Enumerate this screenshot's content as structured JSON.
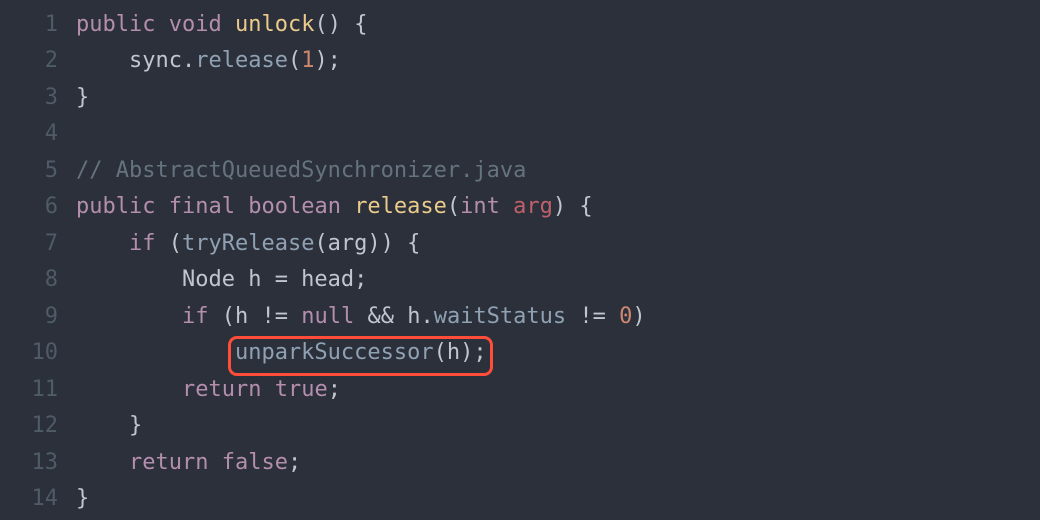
{
  "editor": {
    "language": "java",
    "theme": "dark",
    "highlight": {
      "line": 10,
      "text": "unparkSuccessor(h);"
    },
    "lines": [
      {
        "num": "1",
        "tokens": [
          {
            "t": "kw",
            "v": "public"
          },
          {
            "t": "sp",
            "v": " "
          },
          {
            "t": "kw",
            "v": "void"
          },
          {
            "t": "sp",
            "v": " "
          },
          {
            "t": "fn",
            "v": "unlock"
          },
          {
            "t": "op",
            "v": "() {"
          }
        ]
      },
      {
        "num": "2",
        "indent": "    ",
        "tokens": [
          {
            "t": "id",
            "v": "sync"
          },
          {
            "t": "op",
            "v": "."
          },
          {
            "t": "call",
            "v": "release"
          },
          {
            "t": "op",
            "v": "("
          },
          {
            "t": "num",
            "v": "1"
          },
          {
            "t": "op",
            "v": ");"
          }
        ]
      },
      {
        "num": "3",
        "tokens": [
          {
            "t": "op",
            "v": "}"
          }
        ]
      },
      {
        "num": "4",
        "tokens": []
      },
      {
        "num": "5",
        "tokens": [
          {
            "t": "comm",
            "v": "// AbstractQueuedSynchronizer.java"
          }
        ]
      },
      {
        "num": "6",
        "tokens": [
          {
            "t": "kw",
            "v": "public"
          },
          {
            "t": "sp",
            "v": " "
          },
          {
            "t": "kw",
            "v": "final"
          },
          {
            "t": "sp",
            "v": " "
          },
          {
            "t": "kw",
            "v": "boolean"
          },
          {
            "t": "sp",
            "v": " "
          },
          {
            "t": "fn",
            "v": "release"
          },
          {
            "t": "op",
            "v": "("
          },
          {
            "t": "kw",
            "v": "int"
          },
          {
            "t": "sp",
            "v": " "
          },
          {
            "t": "param",
            "v": "arg"
          },
          {
            "t": "op",
            "v": ") {"
          }
        ]
      },
      {
        "num": "7",
        "indent": "    ",
        "tokens": [
          {
            "t": "kw",
            "v": "if"
          },
          {
            "t": "sp",
            "v": " "
          },
          {
            "t": "op",
            "v": "("
          },
          {
            "t": "call",
            "v": "tryRelease"
          },
          {
            "t": "op",
            "v": "(arg)) {"
          }
        ]
      },
      {
        "num": "8",
        "indent": "        ",
        "tokens": [
          {
            "t": "id",
            "v": "Node h "
          },
          {
            "t": "op",
            "v": "="
          },
          {
            "t": "id",
            "v": " head;"
          }
        ]
      },
      {
        "num": "9",
        "indent": "        ",
        "tokens": [
          {
            "t": "kw",
            "v": "if"
          },
          {
            "t": "sp",
            "v": " "
          },
          {
            "t": "op",
            "v": "(h "
          },
          {
            "t": "op",
            "v": "!="
          },
          {
            "t": "sp",
            "v": " "
          },
          {
            "t": "kw",
            "v": "null"
          },
          {
            "t": "sp",
            "v": " "
          },
          {
            "t": "op",
            "v": "&&"
          },
          {
            "t": "sp",
            "v": " "
          },
          {
            "t": "id",
            "v": "h"
          },
          {
            "t": "op",
            "v": "."
          },
          {
            "t": "call",
            "v": "waitStatus"
          },
          {
            "t": "sp",
            "v": " "
          },
          {
            "t": "op",
            "v": "!="
          },
          {
            "t": "sp",
            "v": " "
          },
          {
            "t": "num",
            "v": "0"
          },
          {
            "t": "op",
            "v": ")"
          }
        ]
      },
      {
        "num": "10",
        "indent": "            ",
        "tokens": [
          {
            "t": "call",
            "v": "unparkSuccessor"
          },
          {
            "t": "op",
            "v": "(h);"
          }
        ]
      },
      {
        "num": "11",
        "indent": "        ",
        "tokens": [
          {
            "t": "kw",
            "v": "return"
          },
          {
            "t": "sp",
            "v": " "
          },
          {
            "t": "kw",
            "v": "true"
          },
          {
            "t": "op",
            "v": ";"
          }
        ]
      },
      {
        "num": "12",
        "indent": "    ",
        "tokens": [
          {
            "t": "op",
            "v": "}"
          }
        ]
      },
      {
        "num": "13",
        "indent": "    ",
        "tokens": [
          {
            "t": "kw",
            "v": "return"
          },
          {
            "t": "sp",
            "v": " "
          },
          {
            "t": "kw",
            "v": "false"
          },
          {
            "t": "op",
            "v": ";"
          }
        ]
      },
      {
        "num": "14",
        "tokens": [
          {
            "t": "op",
            "v": "}"
          }
        ]
      }
    ]
  }
}
